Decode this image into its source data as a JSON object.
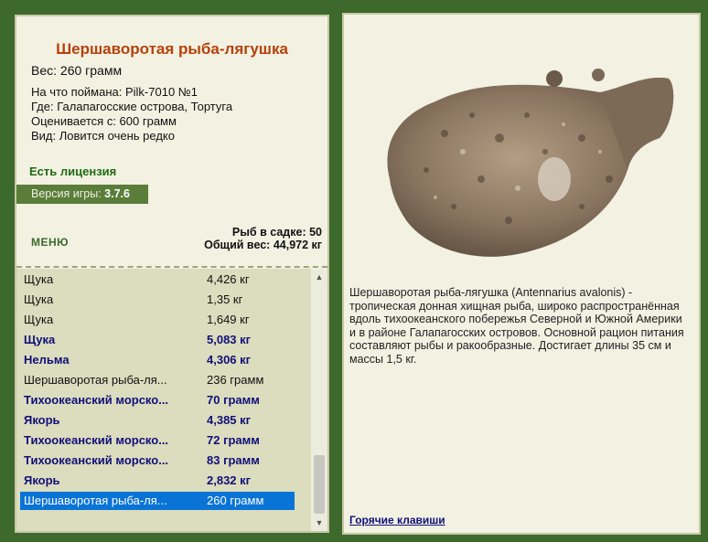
{
  "fish": {
    "title": "Шершаворотая рыба-лягушка",
    "weight": "Вес: 260 грамм",
    "caught_with": "На что поймана: Pilk-7010 №1",
    "location": "Где: Галапагосские острова, Тортуга",
    "valued_from": "Оценивается с: 600 грамм",
    "rarity": "Вид: Ловится очень редко",
    "description": "Шершаворотая рыба-лягушка (Antennarius avalonis) - тропическая донная хищная рыба, широко распространённая вдоль тихоокеанского побережья Северной и Южной Америки и в районе Галапагосских островов. Основной рацион питания составляют рыбы и ракообразные. Достигает длины 35 см и массы 1,5 кг."
  },
  "license_text": "Есть лицензия",
  "version": {
    "label": "Версия игры:",
    "value": "3.7.6"
  },
  "menu_label": "МЕНЮ",
  "stats": {
    "fish_in_net": "Рыб в садке: 50",
    "total_weight": "Общий вес: 44,972 кг"
  },
  "catch_list": [
    {
      "name": "Щука",
      "weight": "4,426 кг",
      "bold": false
    },
    {
      "name": "Щука",
      "weight": "1,35 кг",
      "bold": false
    },
    {
      "name": "Щука",
      "weight": "1,649 кг",
      "bold": false
    },
    {
      "name": "Щука",
      "weight": "5,083 кг",
      "bold": true
    },
    {
      "name": "Нельма",
      "weight": "4,306 кг",
      "bold": true
    },
    {
      "name": "Шершаворотая рыба-ля...",
      "weight": "236 грамм",
      "bold": false
    },
    {
      "name": "Тихоокеанский морско...",
      "weight": "70 грамм",
      "bold": true
    },
    {
      "name": "Якорь",
      "weight": "4,385 кг",
      "bold": true
    },
    {
      "name": "Тихоокеанский морско...",
      "weight": "72 грамм",
      "bold": true
    },
    {
      "name": "Тихоокеанский морско...",
      "weight": "83 грамм",
      "bold": true
    },
    {
      "name": "Якорь",
      "weight": "2,832 кг",
      "bold": true
    },
    {
      "name": "Шершаворотая рыба-ля...",
      "weight": "260 грамм",
      "bold": false,
      "selected": true
    }
  ],
  "hotkeys_label": "Горячие клавиши",
  "colors": {
    "frame": "#3d6a2c",
    "panel": "#f2f1e2",
    "title": "#b5410b",
    "license": "#1f6b12",
    "selection": "#0a74d6",
    "bold_row": "#10107a"
  },
  "icons": {
    "scroll_up": "▲",
    "scroll_down": "▼"
  }
}
